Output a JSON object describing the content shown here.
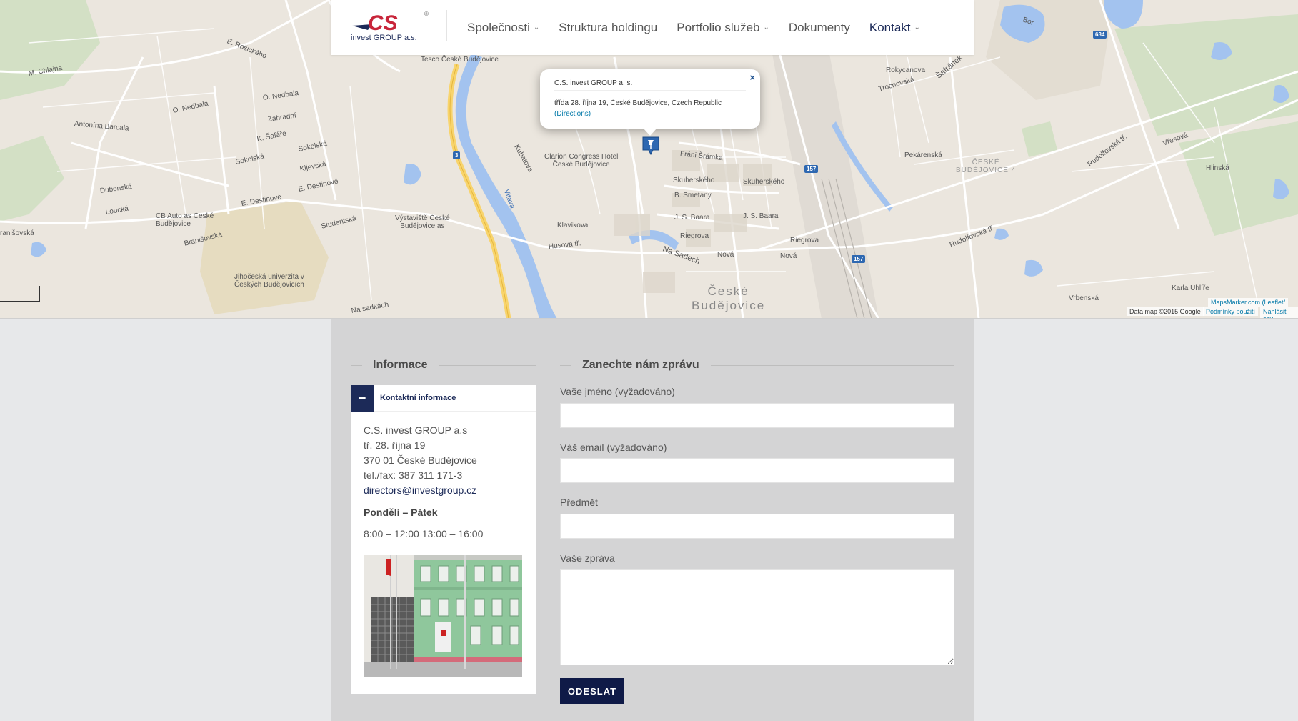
{
  "header": {
    "logo_text": "invest GROUP a.s.",
    "logo_mark": "CS",
    "logo_reg": "®",
    "nav": [
      {
        "label": "Společnosti",
        "dropdown": true
      },
      {
        "label": "Struktura holdingu",
        "dropdown": false
      },
      {
        "label": "Portfolio služeb",
        "dropdown": true
      },
      {
        "label": "Dokumenty",
        "dropdown": false
      },
      {
        "label": "Kontakt",
        "dropdown": true,
        "active": true
      }
    ],
    "chevron": "⌄"
  },
  "map": {
    "popup": {
      "title": "C.S. invest GROUP a. s.",
      "address": "třída 28. října 19, České Budějovice, Czech Republic",
      "directions": "(Directions)",
      "close": "×"
    },
    "labels": {
      "tesco": "Tesco České Budějovice",
      "rosickeho": "E. Rošického",
      "chaina": "M. Chlajna",
      "nedbala": "O. Nedbala",
      "nedbala2": "O. Nedbala",
      "zahradni": "Zahradní",
      "antonina": "Antonína Barcala",
      "safare": "K. Šafáře",
      "sokolska": "Sokolská",
      "sokolska2": "Sokolská",
      "kijevska": "Kijevská",
      "destinove": "E. Destinové",
      "destinove2": "E. Destinové",
      "dubenska": "Dubenská",
      "loucka": "Loucká",
      "cbauto": "CB Auto as České\nBudějovice",
      "branisovska": "Branišovská",
      "branisovska2": "ranišovská",
      "studentska": "Studentská",
      "vystaviste": "Výstaviště České\nBudějovice as",
      "jihoceska": "Jihočeská univerzita v\nČeských Budějovicích",
      "clarion": "Clarion Congress Hotel\nČeské Budějovice",
      "frani": "Fráni Šrámka",
      "skuherskeho": "Skuherského",
      "skuherskeho2": "Skuherského",
      "smetany": "B. Smetany",
      "baara": "J. S. Baara",
      "baara2": "J. S. Baara",
      "riegrova": "Riegrova",
      "riegrova2": "Riegrova",
      "husova": "Husova tř.",
      "nasadech": "Na Sadech",
      "nova": "Nová",
      "nova2": "Nová",
      "nasadkach": "Na sadkách",
      "klavikova": "Klavíkova",
      "kubatova": "Kubatova",
      "pekarenska": "Pekárenská",
      "rudolfovska": "Rudolfovská tř.",
      "rudolfovska2": "Rudolfovská tř.",
      "hlinska": "Hlinská",
      "rokycanova": "Rokycanova",
      "trocnovska": "Trocnovská",
      "safranek": "Šafránek",
      "bor": "Bor",
      "vresova": "Vřesová",
      "vrbenska": "Vrbenská",
      "karla": "Karla Uhlíře",
      "vltava": "Vltava",
      "cb_city": "České\nBudějovice",
      "cb4": "ČESKÉ\nBUDĚJOVICE 4",
      "route3": "3",
      "route157a": "157",
      "route157b": "157",
      "route634": "634"
    },
    "attribution": {
      "data": "Data map ©2015 Google",
      "terms": "Podmínky použití",
      "report": "Nahlásit chy",
      "mapsmarker": "MapsMarker.com (Leaflet/"
    }
  },
  "info": {
    "section_title": "Informace",
    "accordion_toggle": "−",
    "accordion_label": "Kontaktní informace",
    "lines": [
      "C.S. invest GROUP a.s",
      "tř. 28. října 19",
      "370 01 České Budějovice",
      "tel./fax: 387 311 171-3"
    ],
    "email": "directors@investgroup.cz",
    "hours_title": "Pondělí – Pátek",
    "hours": "8:00 – 12:00  13:00 – 16:00"
  },
  "form": {
    "section_title": "Zanechte nám zprávu",
    "name_label": "Vaše jméno (vyžadováno)",
    "email_label": "Váš email (vyžadováno)",
    "subject_label": "Předmět",
    "message_label": "Vaše zpráva",
    "name_value": "",
    "email_value": "",
    "subject_value": "",
    "message_value": "",
    "submit_label": "ODESLAT"
  },
  "colors": {
    "brand": "#1c2a58",
    "button": "#0f1a47",
    "content_bg": "#d4d4d5",
    "page_bg": "#e7e8ea"
  }
}
